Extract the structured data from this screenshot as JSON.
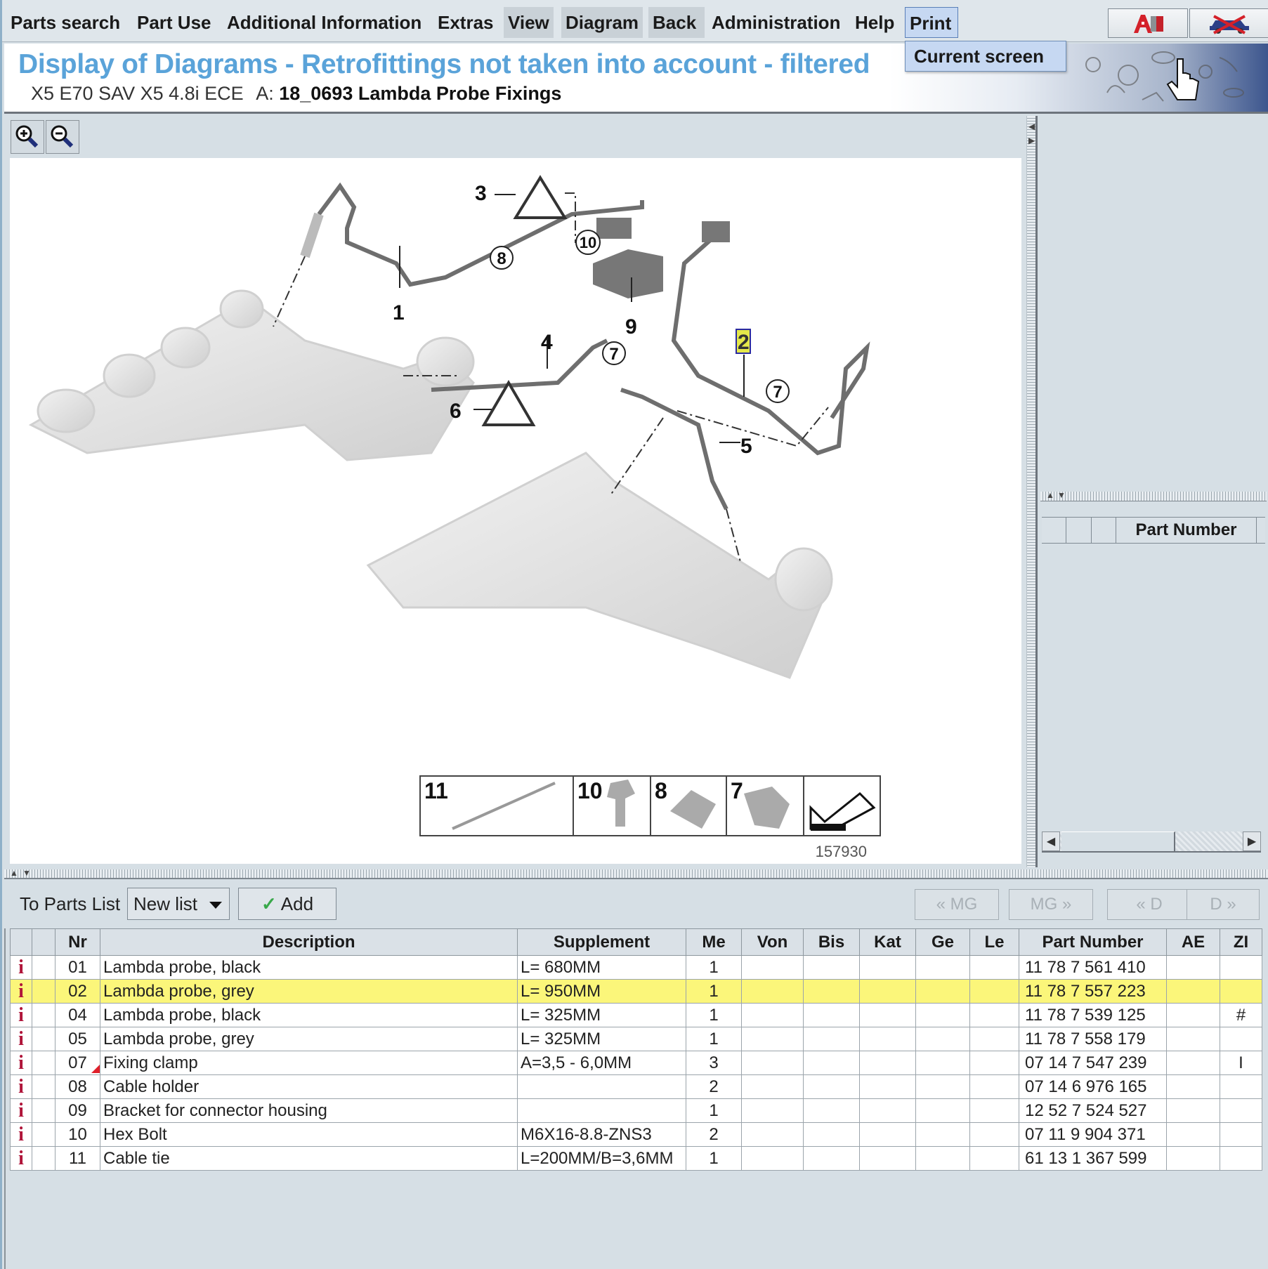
{
  "menu": {
    "items": [
      {
        "label": "Parts search"
      },
      {
        "label": "Part Use"
      },
      {
        "label": "Additional Information"
      },
      {
        "label": "Extras"
      },
      {
        "label": "View"
      },
      {
        "label": "Diagram"
      },
      {
        "label": "Back"
      },
      {
        "label": "Administration"
      },
      {
        "label": "Help"
      },
      {
        "label": "Print"
      }
    ],
    "print_dropdown": {
      "items": [
        {
          "label": "Current screen"
        }
      ]
    },
    "tool_icons": [
      "a-info-icon",
      "vehicle-cancel-icon"
    ]
  },
  "banner": {
    "title": "Display of Diagrams - Retrofittings not taken into account - filtered",
    "vehicle": "X5 E70 SAV X5 4.8i ECE",
    "group_prefix": "A:",
    "group": "18_0693 Lambda Probe Fixings"
  },
  "diagram": {
    "zoom_in_icon": "zoom-in-icon",
    "zoom_out_icon": "zoom-out-icon",
    "image_number": "157930",
    "callouts": [
      "1",
      "2",
      "3",
      "4",
      "5",
      "6",
      "7",
      "7",
      "7",
      "8",
      "9",
      "10"
    ],
    "highlighted_callout": "2",
    "legend": [
      {
        "label": "11"
      },
      {
        "label": "10"
      },
      {
        "label": "8"
      },
      {
        "label": "7"
      }
    ]
  },
  "side_panel": {
    "header": "Part Number"
  },
  "toolbar": {
    "to_parts_list_label": "To Parts List",
    "list_select_value": "New list",
    "add_label": "Add",
    "nav": [
      {
        "label": "« MG"
      },
      {
        "label": "MG »"
      },
      {
        "label": "« D"
      },
      {
        "label": "D »"
      }
    ]
  },
  "parts_table": {
    "columns": [
      "",
      "",
      "Nr",
      "Description",
      "Supplement",
      "Me",
      "Von",
      "Bis",
      "Kat",
      "Ge",
      "Le",
      "Part Number",
      "AE",
      "ZI"
    ],
    "rows": [
      {
        "nr": "01",
        "description": "Lambda probe, black",
        "supplement": "L= 680MM",
        "me": "1",
        "von": "",
        "bis": "",
        "kat": "",
        "ge": "",
        "le": "",
        "part_number": "11 78 7 561 410",
        "ae": "",
        "zi": "",
        "highlighted": false,
        "flag": false
      },
      {
        "nr": "02",
        "description": "Lambda probe, grey",
        "supplement": "L= 950MM",
        "me": "1",
        "von": "",
        "bis": "",
        "kat": "",
        "ge": "",
        "le": "",
        "part_number": "11 78 7 557 223",
        "ae": "",
        "zi": "",
        "highlighted": true,
        "flag": false
      },
      {
        "nr": "04",
        "description": "Lambda probe, black",
        "supplement": "L= 325MM",
        "me": "1",
        "von": "",
        "bis": "",
        "kat": "",
        "ge": "",
        "le": "",
        "part_number": "11 78 7 539 125",
        "ae": "",
        "zi": "#",
        "highlighted": false,
        "flag": false
      },
      {
        "nr": "05",
        "description": "Lambda probe, grey",
        "supplement": "L= 325MM",
        "me": "1",
        "von": "",
        "bis": "",
        "kat": "",
        "ge": "",
        "le": "",
        "part_number": "11 78 7 558 179",
        "ae": "",
        "zi": "",
        "highlighted": false,
        "flag": false
      },
      {
        "nr": "07",
        "description": "Fixing clamp",
        "supplement": "A=3,5 - 6,0MM",
        "me": "3",
        "von": "",
        "bis": "",
        "kat": "",
        "ge": "",
        "le": "",
        "part_number": "07 14 7 547 239",
        "ae": "",
        "zi": "I",
        "highlighted": false,
        "flag": true
      },
      {
        "nr": "08",
        "description": "Cable holder",
        "supplement": "",
        "me": "2",
        "von": "",
        "bis": "",
        "kat": "",
        "ge": "",
        "le": "",
        "part_number": "07 14 6 976 165",
        "ae": "",
        "zi": "",
        "highlighted": false,
        "flag": false
      },
      {
        "nr": "09",
        "description": "Bracket for connector housing",
        "supplement": "",
        "me": "1",
        "von": "",
        "bis": "",
        "kat": "",
        "ge": "",
        "le": "",
        "part_number": "12 52 7 524 527",
        "ae": "",
        "zi": "",
        "highlighted": false,
        "flag": false
      },
      {
        "nr": "10",
        "description": "Hex Bolt",
        "supplement": "M6X16-8.8-ZNS3",
        "me": "2",
        "von": "",
        "bis": "",
        "kat": "",
        "ge": "",
        "le": "",
        "part_number": "07 11 9 904 371",
        "ae": "",
        "zi": "",
        "highlighted": false,
        "flag": false
      },
      {
        "nr": "11",
        "description": "Cable tie",
        "supplement": "L=200MM/B=3,6MM",
        "me": "1",
        "von": "",
        "bis": "",
        "kat": "",
        "ge": "",
        "le": "",
        "part_number": "61 13 1 367 599",
        "ae": "",
        "zi": "",
        "highlighted": false,
        "flag": false
      }
    ],
    "info_icon": "i",
    "colors": {
      "highlight": "#fbf67a",
      "info_icon": "#b0153a",
      "title": "#5aa3d9"
    }
  }
}
